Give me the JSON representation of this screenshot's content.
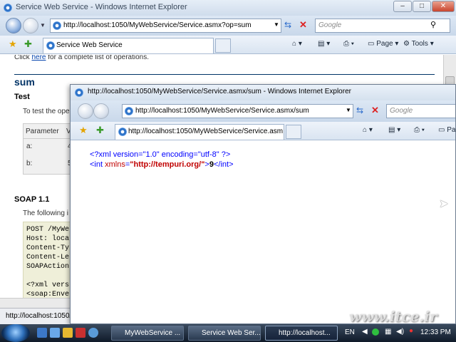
{
  "back_window": {
    "title": "Service Web Service - Windows Internet Explorer",
    "address": "http://localhost:1050/MyWebService/Service.asmx?op=sum",
    "search_placeholder": "Google",
    "tab_label": "Service Web Service",
    "toolbar": {
      "page_label": "Page",
      "tools_label": "Tools"
    },
    "content": {
      "click_pre": "Click ",
      "click_link": "here",
      "click_post": " for a complete list of operations.",
      "op_title": "sum",
      "test_heading": "Test",
      "test_text": "To test the ope",
      "param_header_1": "Parameter",
      "param_header_2": "V",
      "param_a": "a:",
      "param_a_val": "4",
      "param_b": "b:",
      "param_b_val": "5",
      "soap_heading": "SOAP 1.1",
      "soap_text": "The following i",
      "code_lines": [
        "POST /MyWe",
        "Host: loca",
        "Content-Ty",
        "Content-Le",
        "SOAPAction",
        "",
        "<?xml vers",
        "<soap:Enve"
      ]
    },
    "status_text": "http://localhost:1050/"
  },
  "front_window": {
    "title": "http://localhost:1050/MyWebService/Service.asmx/sum - Windows Internet Explorer",
    "address": "http://localhost:1050/MyWebService/Service.asmx/sum",
    "search_placeholder": "Google",
    "tab_label": "http://localhost:1050/MyWebService/Service.asm...",
    "toolbar": {
      "page_label": "Pa"
    },
    "xml": {
      "decl": "<?xml version=\"1.0\" encoding=\"utf-8\" ?>",
      "open_tag": "<int ",
      "attr_name": "xmlns",
      "eq": "=",
      "attr_value": "\"http://tempuri.org/\"",
      "close_bracket": ">",
      "value": "9",
      "end_tag": "</int>"
    }
  },
  "taskbar": {
    "buttons": [
      "MyWebService ...",
      "Service Web Ser...",
      "http://localhost..."
    ],
    "language": "EN",
    "clock": "12:33 PM"
  },
  "watermark": "www.itce.ir"
}
